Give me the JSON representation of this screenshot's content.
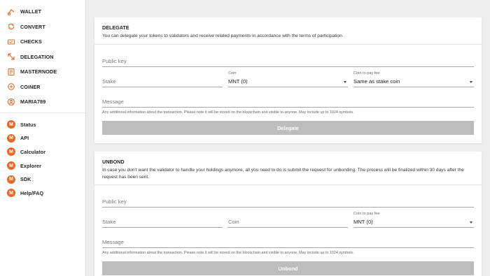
{
  "sidebar": {
    "top_items": [
      {
        "label": "WALLET",
        "icon": "wallet-icon"
      },
      {
        "label": "CONVERT",
        "icon": "convert-icon"
      },
      {
        "label": "CHECKS",
        "icon": "checks-icon"
      },
      {
        "label": "DELEGATION",
        "icon": "delegation-icon"
      },
      {
        "label": "MASTERNODE",
        "icon": "masternode-icon"
      },
      {
        "label": "COINER",
        "icon": "coiner-icon"
      },
      {
        "label": "MARIA789",
        "icon": "user-icon"
      }
    ],
    "bottom_items": [
      {
        "label": "Status",
        "icon": "minter-logo-icon"
      },
      {
        "label": "API",
        "icon": "minter-logo-icon"
      },
      {
        "label": "Calculator",
        "icon": "minter-logo-icon"
      },
      {
        "label": "Explorer",
        "icon": "minter-logo-icon"
      },
      {
        "label": "SDK",
        "icon": "minter-logo-icon"
      },
      {
        "label": "Help/FAQ",
        "icon": "minter-logo-icon"
      }
    ],
    "badge_letter": "M"
  },
  "delegate": {
    "title": "DELEGATE",
    "description": "You can delegate your tokens to validators and receive related payments in accordance with the terms of participation.",
    "public_key_placeholder": "Public key",
    "stake_placeholder": "Stake",
    "coin_label": "Coin",
    "coin_value": "MNT (0)",
    "fee_label": "Coin to pay fee",
    "fee_value": "Same as stake coin",
    "message_placeholder": "Message",
    "hint": "Any additional information about the transaction. Please note it will be stored on the blockchain and visible to anyone. May include up to 1024 symbols.",
    "button": "Delegate"
  },
  "unbond": {
    "title": "UNBOND",
    "description": "In case you don't want the validator to handle your holdings anymore, all you need to do is submit the request for unbonding. The process will be finalized within 30 days after the request has been sent.",
    "public_key_placeholder": "Public key",
    "stake_placeholder": "Stake",
    "coin_placeholder": "Coin",
    "fee_label": "Coin to pay fee",
    "fee_value": "MNT (0)",
    "message_placeholder": "Message",
    "hint": "Any additional information about the transaction. Please note it will be stored on the blockchain and visible to anyone. May include up to 1024 symbols.",
    "button": "Unbond"
  },
  "colors": {
    "accent": "#e36a26",
    "button_disabled": "#bdbdbd"
  }
}
